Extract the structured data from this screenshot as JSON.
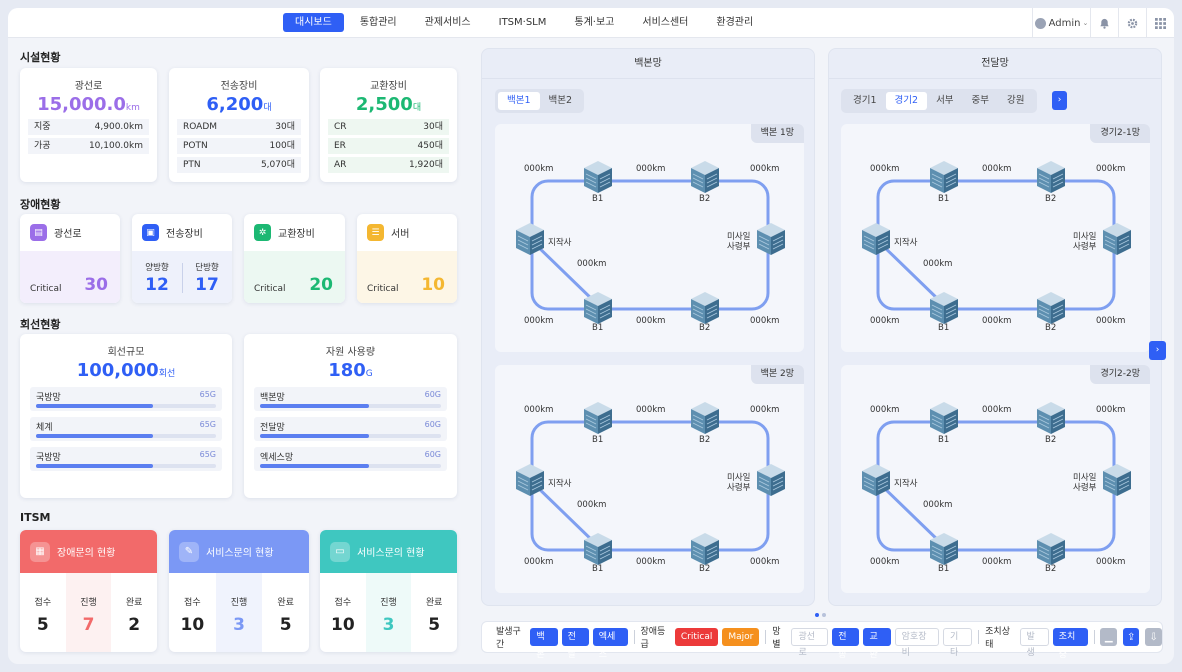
{
  "nav": {
    "items": [
      "대시보드",
      "통합관리",
      "관제서비스",
      "ITSM·SLM",
      "통계·보고",
      "서비스센터",
      "환경관리"
    ],
    "active_index": 0,
    "user": "Admin"
  },
  "facility": {
    "section": "시설현황",
    "cards": [
      {
        "title": "광선로",
        "value": "15,000.0",
        "unit": "km",
        "color": "#9b6ee8",
        "rows": [
          [
            "지중",
            "4,900.0km"
          ],
          [
            "가공",
            "10,100.0km"
          ]
        ]
      },
      {
        "title": "전송장비",
        "value": "6,200",
        "unit": "대",
        "color": "#2f5ff5",
        "rows": [
          [
            "ROADM",
            "30대"
          ],
          [
            "POTN",
            "100대"
          ],
          [
            "PTN",
            "5,070대"
          ]
        ]
      },
      {
        "title": "교환장비",
        "value": "2,500",
        "unit": "대",
        "color": "#1cb873",
        "rows": [
          [
            "CR",
            "30대"
          ],
          [
            "ER",
            "450대"
          ],
          [
            "AR",
            "1,920대"
          ]
        ]
      }
    ]
  },
  "fault": {
    "section": "장애현황",
    "line": {
      "label": "광선로",
      "crit_label": "Critical",
      "value": "30",
      "color": "#9b6ee8"
    },
    "trans": {
      "label": "전송장비",
      "left_label": "양방향",
      "left_value": "12",
      "right_label": "단방향",
      "right_value": "17",
      "color": "#2f5ff5"
    },
    "switch": {
      "label": "교환장비",
      "crit_label": "Critical",
      "value": "20",
      "color": "#1cb873"
    },
    "server": {
      "label": "서버",
      "crit_label": "Critical",
      "value": "10",
      "color": "#f4b731"
    }
  },
  "circuit": {
    "section": "회선현황",
    "scale": {
      "title": "회선규모",
      "value": "100,000",
      "unit": "회선",
      "bars": [
        {
          "label": "국방망",
          "value": "65G",
          "pct": 0.65
        },
        {
          "label": "체계",
          "value": "65G",
          "pct": 0.65
        },
        {
          "label": "국방망",
          "value": "65G",
          "pct": 0.65
        }
      ]
    },
    "usage": {
      "title": "자원 사용량",
      "value": "180",
      "unit": "G",
      "bars": [
        {
          "label": "백본망",
          "value": "60G",
          "pct": 0.6
        },
        {
          "label": "전달망",
          "value": "60G",
          "pct": 0.6
        },
        {
          "label": "엑세스망",
          "value": "60G",
          "pct": 0.6
        }
      ]
    }
  },
  "itsm": {
    "section": "ITSM",
    "cards": [
      {
        "title": "장애문의 현황",
        "color": "#f26a6a",
        "items": [
          {
            "k": "접수",
            "v": "5"
          },
          {
            "k": "진행",
            "v": "7"
          },
          {
            "k": "완료",
            "v": "2"
          }
        ]
      },
      {
        "title": "서비스문의 현황",
        "color": "#7b98f5",
        "items": [
          {
            "k": "접수",
            "v": "10"
          },
          {
            "k": "진행",
            "v": "3"
          },
          {
            "k": "완료",
            "v": "5"
          }
        ]
      },
      {
        "title": "서비스문의 현황",
        "color": "#3fc7c0",
        "items": [
          {
            "k": "접수",
            "v": "10"
          },
          {
            "k": "진행",
            "v": "3"
          },
          {
            "k": "완료",
            "v": "5"
          }
        ]
      }
    ]
  },
  "backbone": {
    "title": "백본망",
    "tabs": [
      "백본1",
      "백본2"
    ],
    "active_tab": 0,
    "nets": [
      {
        "tag": "백본 1망",
        "km": "000km",
        "b1": "B1",
        "b2": "B2",
        "jijaksa": "지작사",
        "misail": "미사일",
        "sarbu": "사령부"
      },
      {
        "tag": "백본 2망",
        "km": "000km",
        "b1": "B1",
        "b2": "B2",
        "jijaksa": "지작사",
        "misail": "미사일",
        "sarbu": "사령부"
      }
    ]
  },
  "transfer": {
    "title": "전달망",
    "tabs": [
      "경기1",
      "경기2",
      "서부",
      "중부",
      "강원"
    ],
    "active_tab": 1,
    "nets": [
      {
        "tag": "경기2-1망",
        "km": "000km",
        "b1": "B1",
        "b2": "B2",
        "jijaksa": "지작사",
        "misail": "미사일",
        "sarbu": "사령부"
      },
      {
        "tag": "경기2-2망",
        "km": "000km",
        "b1": "B1",
        "b2": "B2",
        "jijaksa": "지작사",
        "misail": "미사일",
        "sarbu": "사령부"
      }
    ]
  },
  "filter": {
    "section_label": "발생구간",
    "section_btns": [
      "백본",
      "전달",
      "엑세스"
    ],
    "grade_label": "장애등급",
    "critical": "Critical",
    "major": "Major",
    "net_label": "망별",
    "net_btns": [
      "광선로",
      "전송",
      "교환",
      "암호장비",
      "기타"
    ],
    "action_label": "조치상태",
    "action_btns": [
      "발생",
      "조치중"
    ]
  }
}
